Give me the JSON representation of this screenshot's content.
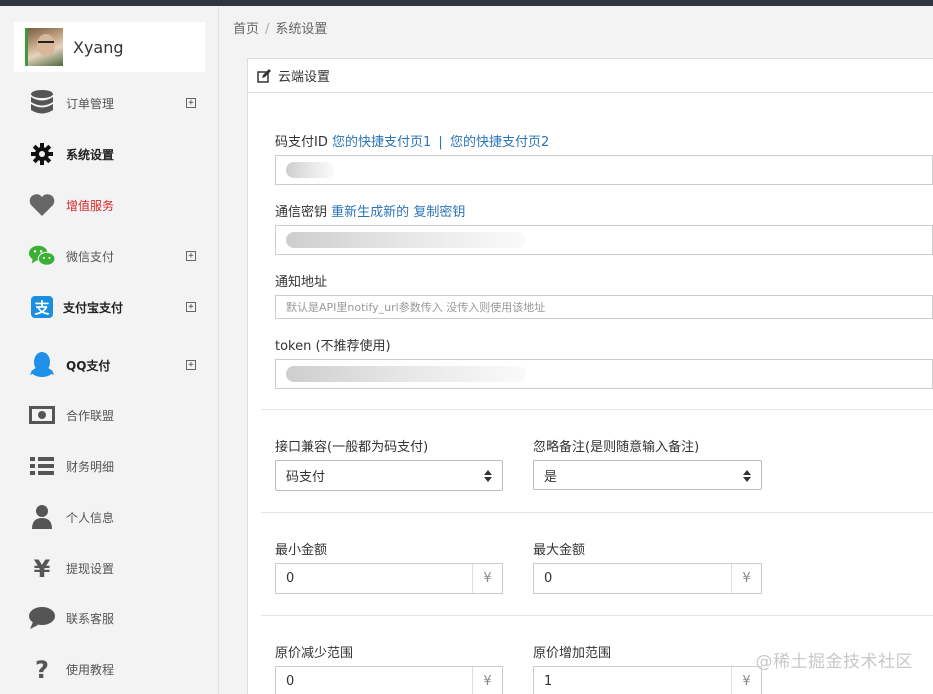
{
  "user": {
    "name": "Xyang"
  },
  "sidebar": {
    "items": [
      {
        "label": "订单管理",
        "icon": "database-icon",
        "expand": "+"
      },
      {
        "label": "系统设置",
        "icon": "gear-icon"
      },
      {
        "label": "增值服务",
        "icon": "heart-icon"
      },
      {
        "label": "微信支付",
        "icon": "wechat-icon",
        "expand": "+"
      },
      {
        "label": "支付宝支付",
        "icon": "alipay-icon",
        "expand": "+"
      },
      {
        "label": "QQ支付",
        "icon": "qq-icon",
        "expand": "+"
      },
      {
        "label": "合作联盟",
        "icon": "money-icon"
      },
      {
        "label": "财务明细",
        "icon": "list-icon"
      },
      {
        "label": "个人信息",
        "icon": "user-icon"
      },
      {
        "label": "提现设置",
        "icon": "yen-icon"
      },
      {
        "label": "联系客服",
        "icon": "chat-icon"
      },
      {
        "label": "使用教程",
        "icon": "question-icon"
      }
    ]
  },
  "breadcrumb": {
    "home": "首页",
    "separator": "/",
    "current": "系统设置"
  },
  "panel": {
    "title": "云端设置"
  },
  "form": {
    "pay_id": {
      "label": "码支付ID",
      "link1": "您的快捷支付页1",
      "separator": "|",
      "link2": "您的快捷支付页2"
    },
    "secret": {
      "label": "通信密钥",
      "link1": "重新生成新的",
      "link2": "复制密钥"
    },
    "notify": {
      "label": "通知地址",
      "placeholder": "默认是API里notify_url参数传入 没传入则使用该地址"
    },
    "token": {
      "label": "token (不推荐使用)"
    },
    "compat": {
      "label": "接口兼容(一般都为码支付)",
      "value": "码支付"
    },
    "ignore_note": {
      "label": "忽略备注(是则随意输入备注)",
      "value": "是"
    },
    "min_amount": {
      "label": "最小金额",
      "value": "0",
      "unit": "¥"
    },
    "max_amount": {
      "label": "最大金额",
      "value": "0",
      "unit": "¥"
    },
    "reduce_range": {
      "label": "原价减少范围",
      "value": "0",
      "unit": "¥"
    },
    "increase_range": {
      "label": "原价增加范围",
      "value": "1",
      "unit": "¥"
    }
  },
  "watermark": "@稀土掘金技术社区",
  "colors": {
    "link": "#2b74b8",
    "accent_red": "#d82828",
    "topbar": "#2f3640"
  }
}
